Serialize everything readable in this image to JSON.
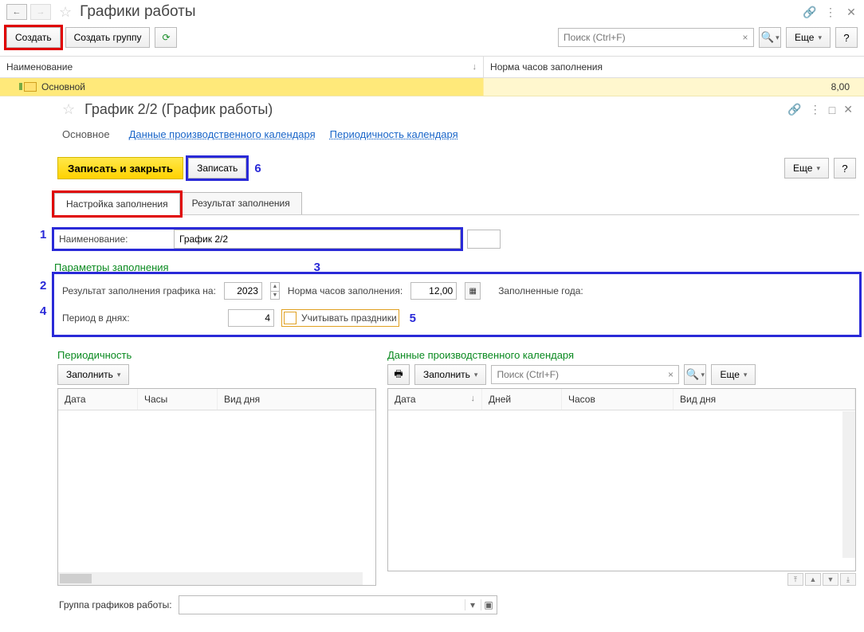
{
  "outer": {
    "title": "Графики работы",
    "toolbar": {
      "create": "Создать",
      "create_group": "Создать группу",
      "search_placeholder": "Поиск (Ctrl+F)",
      "more": "Еще",
      "help": "?"
    },
    "list": {
      "col_name": "Наименование",
      "col_norm": "Норма часов заполнения",
      "rows": [
        {
          "name": "Основной",
          "norm": "8,00"
        }
      ]
    }
  },
  "sub": {
    "title": "График 2/2 (График работы)",
    "nav": {
      "current": "Основное",
      "link_calendar_data": "Данные производственного календаря",
      "link_periodicity": "Периодичность календаря"
    },
    "toolbar": {
      "save_close": "Записать и закрыть",
      "save": "Записать",
      "more": "Еще",
      "help": "?"
    },
    "tabs": {
      "settings": "Настройка заполнения",
      "result": "Результат заполнения"
    },
    "name_field": {
      "label": "Наименование:",
      "value": "График 2/2"
    },
    "params_title": "Параметры заполнения",
    "params": {
      "result_year_label": "Результат заполнения графика на:",
      "year": "2023",
      "norm_label": "Норма часов заполнения:",
      "norm": "12,00",
      "filled_years_label": "Заполненные года:",
      "period_label": "Период в днях:",
      "period": "4",
      "holidays_label": "Учитывать праздники"
    },
    "periodicity": {
      "title": "Периодичность",
      "fill_btn": "Заполнить",
      "cols": {
        "date": "Дата",
        "hours": "Часы",
        "day_type": "Вид дня"
      }
    },
    "calendar_data": {
      "title": "Данные производственного календаря",
      "fill_btn": "Заполнить",
      "search_placeholder": "Поиск (Ctrl+F)",
      "more": "Еще",
      "cols": {
        "date": "Дата",
        "days": "Дней",
        "hours": "Часов",
        "day_type": "Вид дня"
      }
    },
    "bottom": {
      "group_label": "Группа графиков работы:"
    },
    "annotations": {
      "a1": "1",
      "a2": "2",
      "a3": "3",
      "a4": "4",
      "a5": "5",
      "a6": "6"
    }
  }
}
